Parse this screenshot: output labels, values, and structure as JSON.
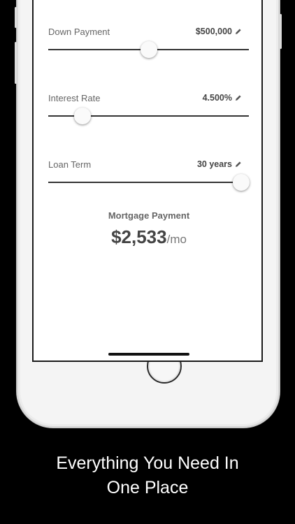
{
  "sliders": [
    {
      "label": "Down Payment",
      "value": "$500,000",
      "position_pct": 50
    },
    {
      "label": "Interest Rate",
      "value": "4.500%",
      "position_pct": 17
    },
    {
      "label": "Loan Term",
      "value": "30 years",
      "position_pct": 96
    }
  ],
  "payment": {
    "title": "Mortgage Payment",
    "amount": "$2,533",
    "unit": "/mo"
  },
  "caption": {
    "line1": "Everything You Need In",
    "line2": "One Place"
  },
  "colors": {
    "background": "#000000",
    "track": "#333333",
    "text": "#444444"
  },
  "icons": [
    "pencil-icon"
  ]
}
